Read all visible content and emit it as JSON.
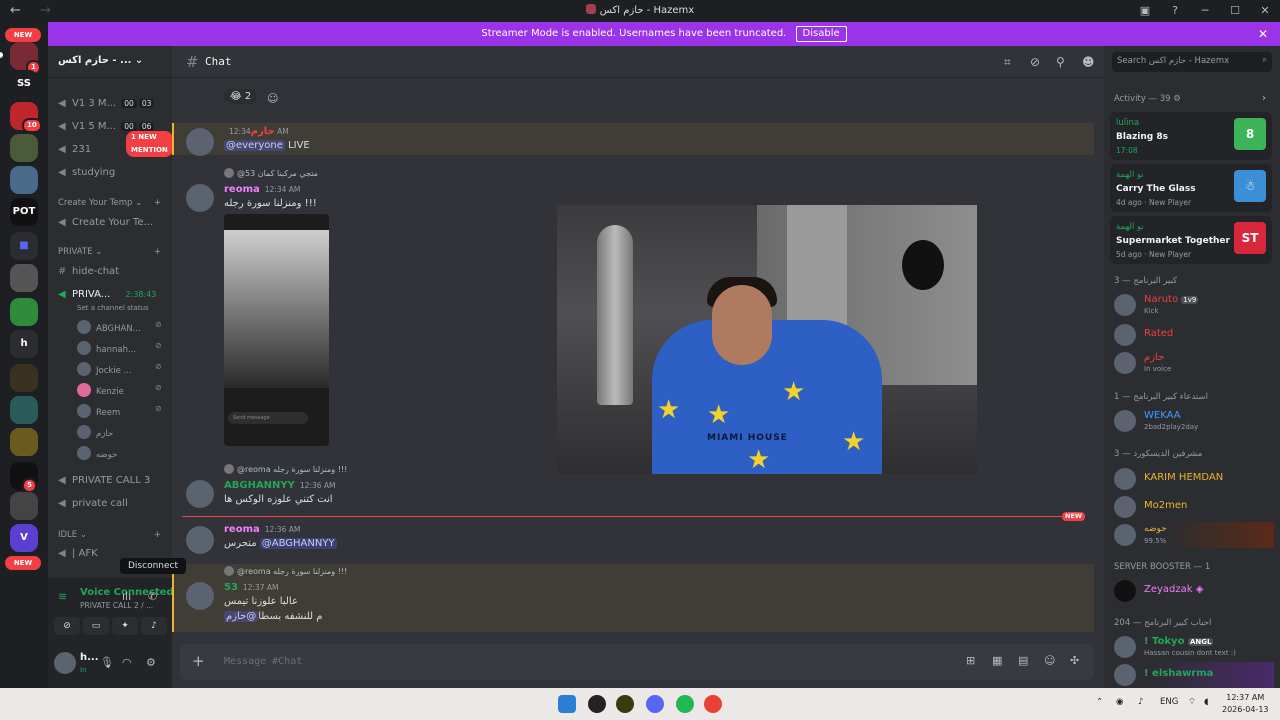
{
  "window": {
    "title": "حازم اكس - Hazemx",
    "back": "←",
    "forward": "→"
  },
  "banner": {
    "text": "Streamer Mode is enabled. Usernames have been truncated.",
    "disable": "Disable",
    "close": "✕"
  },
  "rail": {
    "new_top": "NEW",
    "new_bottom": "NEW",
    "badges": [
      "1",
      "10",
      "5",
      "8"
    ],
    "labels": {
      "ss": "SS",
      "h": "h",
      "pot": "POT"
    }
  },
  "server": {
    "name": "حازم اكس - ..."
  },
  "channels": {
    "new_mention": "1 NEW MENTION",
    "items": [
      {
        "name": "V1 3 M...",
        "c1": "00",
        "c2": "03"
      },
      {
        "name": "V1 5 M...",
        "c1": "00",
        "c2": "06"
      },
      {
        "name": "231"
      },
      {
        "name": "studying"
      }
    ],
    "cat_temp": "Create Your Temp",
    "create_temp": "Create Your Te...",
    "cat_private": "PRIVATE",
    "hide_chat": "hide-chat",
    "private_voice": "PRIVA...",
    "private_timer": "2:38:43",
    "set_status": "Set a channel status",
    "voice_users": [
      "ABGHAN...",
      "hannah...",
      "Jockie ...",
      "Kenzie",
      "Reem",
      "حازم",
      "حوضه"
    ],
    "private_call_3": "PRIVATE CALL 3",
    "private_call": "private call",
    "cat_idle": "IDLE",
    "afk": "| AFK",
    "tooltip": "Disconnect"
  },
  "voice_panel": {
    "status": "Voice Connected",
    "sub": "PRIVATE CALL 2 / ...",
    "user": "h...",
    "user_status": "In"
  },
  "chat": {
    "channel": "Chat",
    "reaction_count": "2",
    "reaction_emoji": "😂",
    "messages": [
      {
        "author": "حازم",
        "time": "12:34 AM",
        "mention": "@everyone",
        "text": "LIVE"
      },
      {
        "reply": "@53 متجي مركبنا كمان",
        "author": "reoma",
        "time": "12:34 AM",
        "text": "ومنزلنا سورة رجله !!!"
      },
      {
        "reply": "@reoma ومنزلنا سورة رجله !!!",
        "author": "ABGHANNYY",
        "time": "12:36 AM",
        "text": "انت كتني علوزه الوكس ها"
      },
      {
        "author": "reoma",
        "time": "12:36 AM",
        "text": "متحرس",
        "mention": "@ABGHANNYY"
      },
      {
        "reply": "@reoma ومنزلنا سورة رجله !!!",
        "author": "53",
        "time": "12:37 AM",
        "text": "عالبا علوزنا تيمس",
        "text2": "م للنشفه بسطا",
        "mention2": "@حازم"
      }
    ],
    "new_tag": "NEW",
    "video_shirt_text": "MIAMI HOUSE",
    "phone_bar": "Send message",
    "placeholder": "Message #Chat"
  },
  "side": {
    "search": "Search حازم اكس - Hazemx",
    "activity_header": "Activity — 39",
    "activities": [
      {
        "name": "lulina",
        "game": "Blazing 8s",
        "meta": "17:08",
        "thumb": "8"
      },
      {
        "name": "نو الهمة",
        "game": "Carry The Glass",
        "meta": "4d ago",
        "meta2": "New Player",
        "thumb": "☃"
      },
      {
        "name": "نو الهمة",
        "game": "Supermarket Together",
        "meta": "5d ago",
        "meta2": "New Player",
        "thumb": "ST"
      }
    ],
    "groups": [
      {
        "header": "كبير البرنامج — 3",
        "members": [
          {
            "name": "Naruto",
            "tag": "1v9",
            "status": "Kick",
            "color": "#f23f43"
          },
          {
            "name": "Rated",
            "status": "",
            "color": "#f23f43"
          },
          {
            "name": "حازم",
            "status": "In voice",
            "color": "#f23f43"
          }
        ]
      },
      {
        "header": "استدعاء كبير البرنامج — 1",
        "members": [
          {
            "name": "WEKAA",
            "status": "2bad2play2day",
            "color": "#3aa0ff"
          }
        ]
      },
      {
        "header": "مشرفين الديسكورد — 3",
        "members": [
          {
            "name": "KARIM HEMDAN",
            "status": "",
            "color": "#f0b132"
          },
          {
            "name": "Mo2men",
            "status": "",
            "color": "#f0b132"
          },
          {
            "name": "حوضه",
            "status": "99.5%",
            "color": "#f0b132"
          }
        ]
      },
      {
        "header": "SERVER BOOSTER — 1",
        "members": [
          {
            "name": "Zeyadzak",
            "status": "",
            "color": "#f47fff"
          }
        ]
      },
      {
        "header": "احباب كبير البرنامج — 204",
        "members": [
          {
            "name": "! Tokyo",
            "tag": "ANGL",
            "status": "Hassan cousin dont text :)",
            "color": "#23a55a"
          },
          {
            "name": "! elshawrma",
            "status": "",
            "color": "#23a55a"
          }
        ]
      }
    ]
  },
  "taskbar": {
    "lang": "ENG",
    "time": "12:37 AM",
    "date": "2026-04-13"
  },
  "colors": {
    "accent": "#9b33e8",
    "brand": "#5865f2",
    "danger": "#f23f43",
    "online": "#23a55a"
  }
}
